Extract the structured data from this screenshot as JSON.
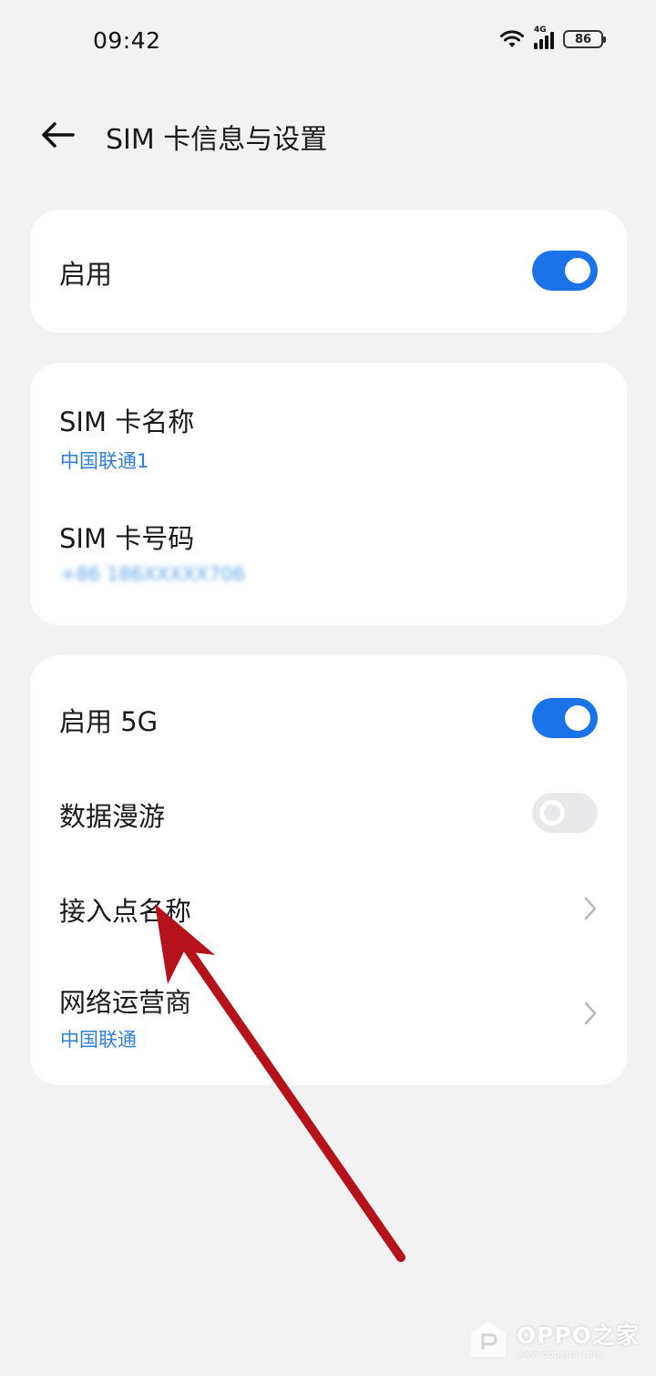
{
  "status_bar": {
    "time": "09:42",
    "network_label": "4G",
    "battery": "86",
    "icons": [
      "wifi-icon",
      "signal-icon",
      "battery-icon"
    ]
  },
  "header": {
    "title": "SIM 卡信息与设置",
    "back_icon": "arrow-left-icon"
  },
  "enable_card": {
    "label": "启用",
    "toggle_on": true
  },
  "sim_card": {
    "name_label": "SIM 卡名称",
    "name_value": "中国联通1",
    "number_label": "SIM 卡号码",
    "number_value": "+86 186XXXXX706"
  },
  "network_card": {
    "enable_5g_label": "启用 5G",
    "enable_5g_on": true,
    "roaming_label": "数据漫游",
    "roaming_on": false,
    "apn_label": "接入点名称",
    "operator_label": "网络运营商",
    "operator_value": "中国联通"
  },
  "colors": {
    "accent": "#1a73e8",
    "link_blue": "#2e7fd8",
    "annotation_red": "#b5121b",
    "background": "#f2f2f3"
  },
  "watermark": {
    "title": "OPPO之家",
    "url": "www.oppojia.com"
  }
}
